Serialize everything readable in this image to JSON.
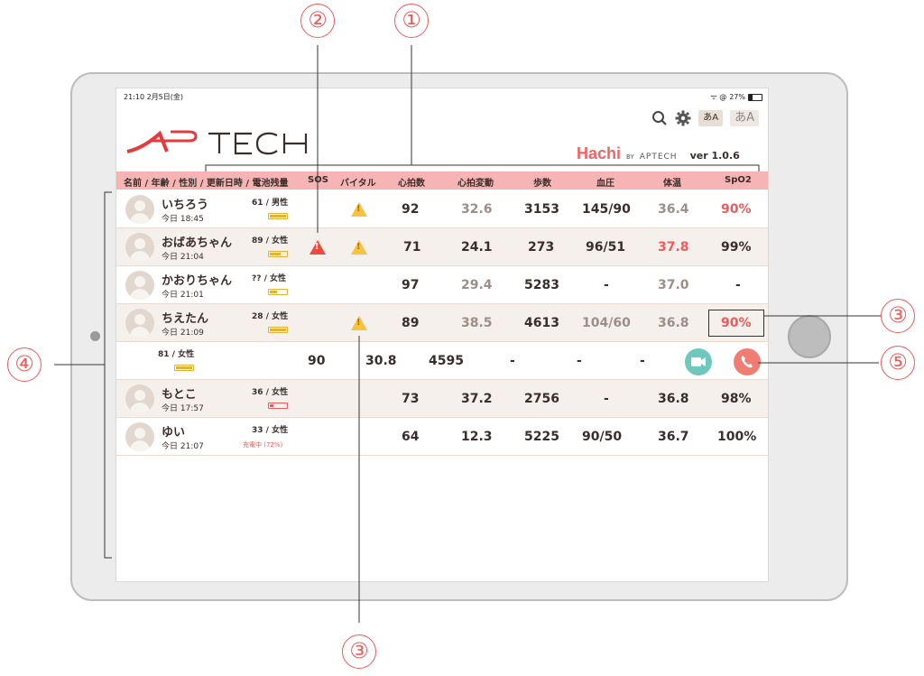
{
  "status": {
    "time_date": "21:10  2月5日(金)",
    "right": "27%"
  },
  "toolbar": {
    "font_small": "あA",
    "font_large": "あA"
  },
  "logo_text": "APTECH",
  "hachi": {
    "brand": "Hachi",
    "by": "BY",
    "by_logo": "APTECH",
    "version": "ver 1.0.6"
  },
  "header": {
    "name_col": "名前 / 年齢 / 性別 / 更新日時 / 電池残量",
    "sos": "SOS",
    "vital": "バイタル",
    "heart_rate": "心拍数",
    "hrv": "心拍変動",
    "steps": "歩数",
    "bp": "血圧",
    "temp": "体温",
    "spo2": "SpO2"
  },
  "rows": [
    {
      "name": "いちろう",
      "age": "61",
      "sex": "男性",
      "time": "今日 18:45",
      "hr": "92",
      "hrv": "32.6",
      "steps": "3153",
      "bp": "145/90",
      "temp": "36.4",
      "spo2": "90%"
    },
    {
      "name": "おばあちゃん",
      "age": "89",
      "sex": "女性",
      "time": "今日 21:04",
      "hr": "71",
      "hrv": "24.1",
      "steps": "273",
      "bp": "96/51",
      "temp": "37.8",
      "spo2": "99%"
    },
    {
      "name": "かおりちゃん",
      "age": "??",
      "sex": "女性",
      "time": "今日 21:01",
      "hr": "97",
      "hrv": "29.4",
      "steps": "5283",
      "bp": "-",
      "temp": "37.0",
      "spo2": "-"
    },
    {
      "name": "ちえたん",
      "age": "28",
      "sex": "女性",
      "time": "今日 21:09",
      "hr": "89",
      "hrv": "38.5",
      "steps": "4613",
      "bp": "104/60",
      "temp": "36.8",
      "spo2": "90%"
    },
    {
      "name": "",
      "age": "81",
      "sex": "女性",
      "time": "",
      "hr": "90",
      "hrv": "30.8",
      "steps": "4595",
      "bp": "-",
      "temp": "-",
      "spo2": "-"
    },
    {
      "name": "もとこ",
      "age": "36",
      "sex": "女性",
      "time": "今日 17:57",
      "hr": "73",
      "hrv": "37.2",
      "steps": "2756",
      "bp": "-",
      "temp": "36.8",
      "spo2": "98%"
    },
    {
      "name": "ゆい",
      "age": "33",
      "sex": "女性",
      "time": "今日 21:07",
      "charging": "充電中 (72%)",
      "hr": "64",
      "hrv": "12.3",
      "steps": "5225",
      "bp": "90/50",
      "temp": "36.7",
      "spo2": "100%"
    }
  ],
  "annotations": [
    "①",
    "②",
    "③",
    "③",
    "④",
    "⑤"
  ],
  "colors": {
    "header_bg": "#f7b4b4",
    "alert_red": "#f05a5a",
    "warn_yellow": "#f7c23e",
    "video_btn": "#6ec8be",
    "phone_btn": "#f07c72"
  }
}
